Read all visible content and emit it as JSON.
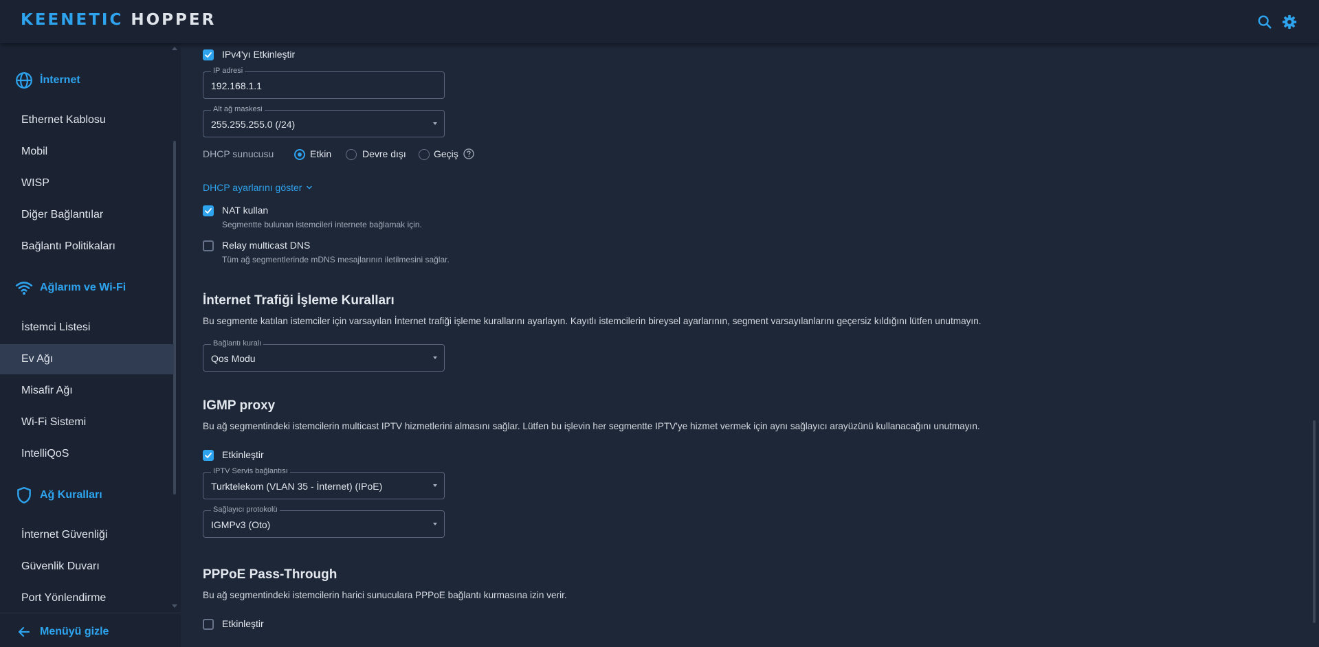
{
  "header": {
    "logo_brand": "KEENETIC",
    "logo_product": "HOPPER",
    "icons": [
      "search-icon",
      "gear-icon"
    ],
    "accent_color": "#2ea3ee"
  },
  "sidebar": {
    "sections": [
      {
        "label": "İnternet",
        "icon": "globe-icon"
      },
      {
        "label": "Ağlarım ve Wi-Fi",
        "icon": "wifi-icon"
      },
      {
        "label": "Ağ Kuralları",
        "icon": "shield-icon"
      }
    ],
    "internet_items": [
      "Ethernet Kablosu",
      "Mobil",
      "WISP",
      "Diğer Bağlantılar",
      "Bağlantı Politikaları"
    ],
    "network_items": [
      "İstemci Listesi",
      "Ev Ağı",
      "Misafir Ağı",
      "Wi-Fi Sistemi",
      "IntelliQoS"
    ],
    "rules_items": [
      "İnternet Güvenliği",
      "Güvenlik Duvarı",
      "Port Yönlendirme"
    ],
    "active_item": "Ev Ağı",
    "hide_menu_label": "Menüyü gizle"
  },
  "main": {
    "ipv4_enable": {
      "label": "IPv4'yı Etkinleştir",
      "checked": true
    },
    "ip_address": {
      "legend": "IP adresi",
      "value": "192.168.1.1"
    },
    "subnet_mask": {
      "legend": "Alt ağ maskesi",
      "value": "255.255.255.0 (/24)"
    },
    "dhcp_server": {
      "label": "DHCP sunucusu",
      "options": [
        "Etkin",
        "Devre dışı",
        "Geçiş"
      ],
      "selected": "Etkin"
    },
    "dhcp_settings_link": "DHCP ayarlarını göster",
    "nat": {
      "label": "NAT kullan",
      "hint": "Segmentte bulunan istemcileri internete bağlamak için.",
      "checked": true
    },
    "relay_dns": {
      "label": "Relay multicast DNS",
      "hint": "Tüm ağ segmentlerinde mDNS mesajlarının iletilmesini sağlar.",
      "checked": false
    },
    "traffic_rules": {
      "title": "İnternet Trafiği İşleme Kuralları",
      "description": "Bu segmente katılan istemciler için varsayılan İnternet trafiği işleme kurallarını ayarlayın. Kayıtlı istemcilerin bireysel ayarlarının, segment varsayılanlarını geçersiz kıldığını lütfen unutmayın.",
      "connection_rule": {
        "legend": "Bağlantı kuralı",
        "value": "Qos Modu"
      }
    },
    "igmp": {
      "title": "IGMP proxy",
      "description": "Bu ağ segmentindeki istemcilerin multicast IPTV hizmetlerini almasını sağlar. Lütfen bu işlevin her segmentte IPTV'ye hizmet vermek için aynı sağlayıcı arayüzünü kullanacağını unutmayın.",
      "enable": {
        "label": "Etkinleştir",
        "checked": true
      },
      "iptv_service": {
        "legend": "IPTV Servis bağlantısı",
        "value": "Turktelekom (VLAN 35 - İnternet) (IPoE)"
      },
      "provider_protocol": {
        "legend": "Sağlayıcı protokolü",
        "value": "IGMPv3 (Oto)"
      }
    },
    "pppoe": {
      "title": "PPPoE Pass-Through",
      "description": "Bu ağ segmentindeki istemcilerin harici sunuculara PPPoE bağlantı kurmasına izin verir.",
      "enable": {
        "label": "Etkinleştir",
        "checked": false
      }
    }
  }
}
